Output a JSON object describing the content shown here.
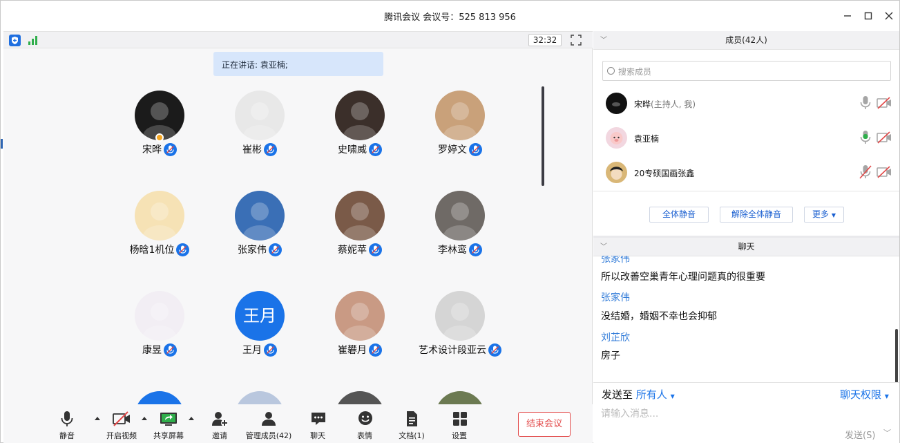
{
  "window": {
    "title": "腾讯会议 会议号：525 813 956",
    "minimize_icon": "minimize-icon",
    "maximize_icon": "maximize-icon",
    "close_icon": "close-icon"
  },
  "status_bar": {
    "timer": "32:32"
  },
  "speaking": {
    "text": "正在讲话: 袁亚楠;"
  },
  "participants": [
    {
      "name": "宋晔",
      "avatar_color": "#1b1b1b",
      "host": true
    },
    {
      "name": "崔彬",
      "avatar_color": "#e8e8e8"
    },
    {
      "name": "史啸威",
      "avatar_color": "#3b2f2a"
    },
    {
      "name": "罗婷文",
      "avatar_color": "#c9a17a"
    },
    {
      "name": "杨晗1机位",
      "avatar_color": "#f6e2b5"
    },
    {
      "name": "张家伟",
      "avatar_color": "#3a6fb6"
    },
    {
      "name": "蔡妮苹",
      "avatar_color": "#7a5a48"
    },
    {
      "name": "李林鸾",
      "avatar_color": "#6f6a66"
    },
    {
      "name": "康昱",
      "avatar_color": "#f2eef4"
    },
    {
      "name": "王月",
      "avatar_color": "#1a73e8",
      "avatar_text": "王月"
    },
    {
      "name": "崔礬月",
      "avatar_color": "#c99a84"
    },
    {
      "name": "艺术设计段亚云",
      "avatar_color": "#d5d5d5"
    }
  ],
  "toolbar": {
    "mute": "静音",
    "video": "开启视频",
    "share": "共享屏幕",
    "invite": "邀请",
    "manage": "管理成员(42)",
    "chat": "聊天",
    "emoji": "表情",
    "docs": "文档(1)",
    "settings": "设置",
    "end": "结束会议"
  },
  "members_panel": {
    "header": "成员(42人)",
    "search_placeholder": "搜索成员",
    "members": [
      {
        "name": "宋晔",
        "note": "(主持人, 我)",
        "mic": "off"
      },
      {
        "name": "袁亚楠",
        "note": "",
        "mic": "active"
      },
      {
        "name": "20专硕国画张鑫",
        "note": "",
        "mic": "muted"
      }
    ],
    "mute_all": "全体静音",
    "unmute_all": "解除全体静音",
    "more": "更多"
  },
  "chat_panel": {
    "header": "聊天",
    "messages": [
      {
        "sender": "张家伟",
        "text": "所以改善空巢青年心理问题真的很重要"
      },
      {
        "sender": "张家伟",
        "text": "没结婚，婚姻不幸也会抑郁"
      },
      {
        "sender": "刘芷欣",
        "text": "房子"
      }
    ],
    "send_to_label": "发送至",
    "send_to_target": "所有人",
    "permission": "聊天权限",
    "input_placeholder": "请输入消息...",
    "send_button": "发送(S)"
  },
  "colors": {
    "accent": "#1a73e8",
    "end_red": "#e24848",
    "speaking_bg": "#d7e6fb"
  }
}
